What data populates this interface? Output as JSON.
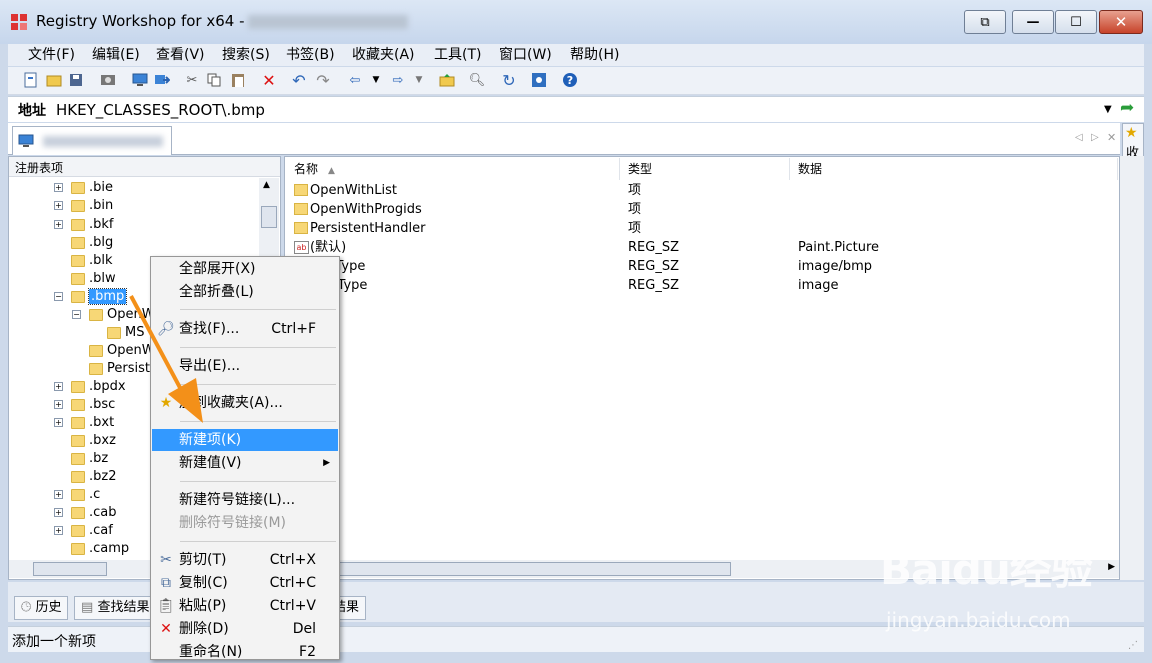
{
  "window": {
    "title": "Registry Workshop for x64 -",
    "controls": [
      "restore-down",
      "minimize",
      "maximize",
      "close"
    ]
  },
  "menu": [
    "文件(F)",
    "编辑(E)",
    "查看(V)",
    "搜索(S)",
    "书签(B)",
    "收藏夹(A)",
    "工具(T)",
    "窗口(W)",
    "帮助(H)"
  ],
  "address": {
    "label": "地址",
    "value": "HKEY_CLASSES_ROOT\\.bmp"
  },
  "favorites_label": "收藏夹",
  "tree": {
    "header": "注册表项",
    "items": [
      {
        "label": ".bie",
        "expander": "+"
      },
      {
        "label": ".bin",
        "expander": "+"
      },
      {
        "label": ".bkf",
        "expander": "+"
      },
      {
        "label": ".blg",
        "expander": ""
      },
      {
        "label": ".blk",
        "expander": ""
      },
      {
        "label": ".blw",
        "expander": ""
      },
      {
        "label": ".bmp",
        "expander": "−",
        "selected": true
      },
      {
        "label": "OpenW",
        "expander": "−",
        "level": 1
      },
      {
        "label": "MS",
        "expander": "",
        "level": 2
      },
      {
        "label": "OpenW",
        "expander": "",
        "level": 1
      },
      {
        "label": "Persiste",
        "expander": "",
        "level": 1
      },
      {
        "label": ".bpdx",
        "expander": "+"
      },
      {
        "label": ".bsc",
        "expander": "+"
      },
      {
        "label": ".bxt",
        "expander": "+"
      },
      {
        "label": ".bxz",
        "expander": ""
      },
      {
        "label": ".bz",
        "expander": ""
      },
      {
        "label": ".bz2",
        "expander": ""
      },
      {
        "label": ".c",
        "expander": "+"
      },
      {
        "label": ".cab",
        "expander": "+"
      },
      {
        "label": ".caf",
        "expander": "+"
      },
      {
        "label": ".camp",
        "expander": ""
      }
    ]
  },
  "list": {
    "columns": [
      "名称",
      "类型",
      "数据"
    ],
    "rows": [
      {
        "name": "OpenWithList",
        "type": "项",
        "data": "",
        "icon": "folder"
      },
      {
        "name": "OpenWithProgids",
        "type": "项",
        "data": "",
        "icon": "folder"
      },
      {
        "name": "PersistentHandler",
        "type": "项",
        "data": "",
        "icon": "folder"
      },
      {
        "name": "(默认)",
        "type": "REG_SZ",
        "data": "Paint.Picture",
        "icon": "string"
      },
      {
        "name": "ent Type",
        "type": "REG_SZ",
        "data": "image/bmp",
        "icon": "string"
      },
      {
        "name": "ivedType",
        "type": "REG_SZ",
        "data": "image",
        "icon": "string"
      }
    ]
  },
  "bottom_tabs": [
    "历史",
    "查找结果",
    "结果"
  ],
  "status": "添加一个新项",
  "context_menu": [
    {
      "label": "全部展开(X)",
      "shortcut": ""
    },
    {
      "label": "全部折叠(L)",
      "shortcut": ""
    },
    {
      "label": "查找(F)...",
      "shortcut": "Ctrl+F",
      "icon": "search-icon"
    },
    {
      "label": "导出(E)...",
      "shortcut": ""
    },
    {
      "label": "加到收藏夹(A)...",
      "shortcut": "",
      "icon": "star-icon"
    },
    {
      "label": "新建项(K)",
      "shortcut": "",
      "highlighted": true
    },
    {
      "label": "新建值(V)",
      "shortcut": "",
      "submenu": true
    },
    {
      "label": "新建符号链接(L)...",
      "shortcut": ""
    },
    {
      "label": "删除符号链接(M)",
      "shortcut": "",
      "disabled": true
    },
    {
      "label": "剪切(T)",
      "shortcut": "Ctrl+X",
      "icon": "cut-icon"
    },
    {
      "label": "复制(C)",
      "shortcut": "Ctrl+C",
      "icon": "copy-icon"
    },
    {
      "label": "粘贴(P)",
      "shortcut": "Ctrl+V",
      "icon": "paste-icon"
    },
    {
      "label": "删除(D)",
      "shortcut": "Del",
      "icon": "delete-icon"
    },
    {
      "label": "重命名(N)",
      "shortcut": "F2"
    }
  ],
  "watermark": {
    "logo": "Baidu经验",
    "url": "jingyan.baidu.com"
  },
  "colors": {
    "accent": "#3399ff",
    "arrow": "#f39019",
    "title_bg": "#cdd9ea"
  }
}
